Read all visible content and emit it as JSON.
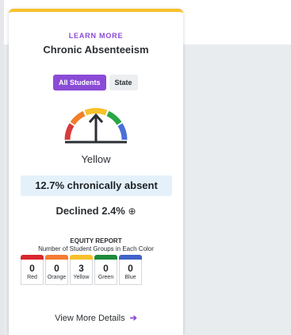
{
  "card": {
    "eyebrow": "LEARN MORE",
    "title": "Chronic Absenteeism",
    "toggle": {
      "active_label": "All Students",
      "inactive_label": "State"
    },
    "gauge": {
      "level": "Yellow",
      "segments": [
        "#d93a3a",
        "#f07f2d",
        "#f7c12b",
        "#28a745",
        "#4a6fd8"
      ]
    },
    "stat": "12.7% chronically absent",
    "change": {
      "text": "Declined 2.4%",
      "icon": "down-circle-arrow-icon"
    },
    "equity": {
      "title": "EQUITY REPORT",
      "subtitle": "Number of Student Groups in Each Color",
      "groups": [
        {
          "count": "0",
          "name": "Red",
          "color": "#d9272e"
        },
        {
          "count": "0",
          "name": "Orange",
          "color": "#f47c30"
        },
        {
          "count": "3",
          "name": "Yellow",
          "color": "#f7c12b"
        },
        {
          "count": "0",
          "name": "Green",
          "color": "#1f8a3b"
        },
        {
          "count": "0",
          "name": "Blue",
          "color": "#3f63c9"
        }
      ]
    },
    "details_link": "View More Details"
  },
  "colors": {
    "accent": "#8a4bd6",
    "top_border": "#f7c12b"
  }
}
